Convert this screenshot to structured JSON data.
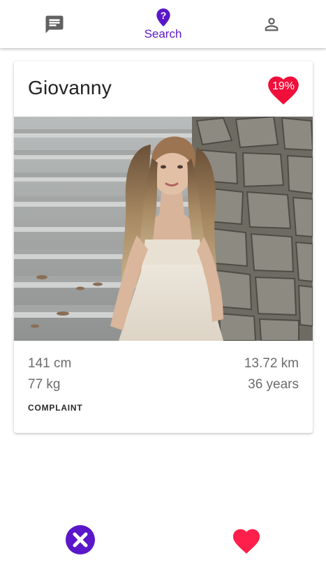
{
  "nav": {
    "tabs": [
      {
        "icon": "chat-icon",
        "label": ""
      },
      {
        "icon": "location-question-icon",
        "label": "Search",
        "active": true
      },
      {
        "icon": "person-icon",
        "label": ""
      }
    ],
    "accent_color": "#5a17c9",
    "inactive_color": "#616161"
  },
  "card": {
    "name": "Giovanny",
    "match_percent": "19%",
    "match_heart_color": "#f00f3a",
    "photo": "profile-photo",
    "height": "141 cm",
    "weight": "77 kg",
    "distance": "13.72 km",
    "age": "36 years",
    "complaint_label": "COMPLAINT"
  },
  "actions": {
    "dislike": {
      "icon": "close-icon",
      "color": "#5a17c9"
    },
    "like": {
      "icon": "heart-icon",
      "color": "#ff1f4b"
    }
  }
}
